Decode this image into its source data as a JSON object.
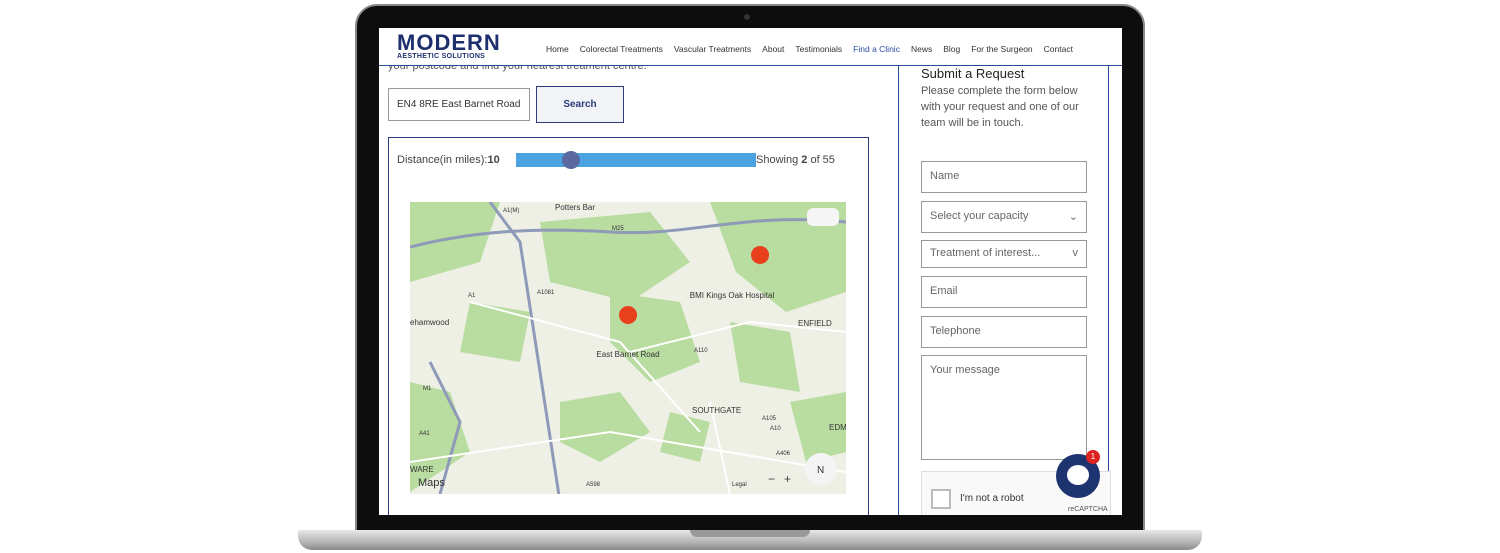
{
  "header": {
    "logo_main": "MODERN",
    "logo_sub": "AESTHETIC SOLUTIONS",
    "nav": [
      "Home",
      "Colorectal Treatments",
      "Vascular Treatments",
      "About",
      "Testimonials",
      "Find a Clinic",
      "News",
      "Blog",
      "For the Surgeon",
      "Contact"
    ],
    "active": "Find a Clinic"
  },
  "intro": "your postcode and find your nearest treament centre.",
  "search": {
    "value": "EN4 8RE East Barnet Road",
    "button": "Search"
  },
  "filter": {
    "label": "Distance(in miles):",
    "distance": "10",
    "slider_fraction": 0.2,
    "showing_prefix": "Showing ",
    "showing_count": "2",
    "showing_suffix": " of 55"
  },
  "map": {
    "labels": [
      "Potters Bar",
      "ehamwood",
      "ENFIELD",
      "SOUTHGATE",
      "EDMO",
      "WARE"
    ],
    "roads": [
      "A1(M)",
      "M25",
      "A1",
      "A1081",
      "A110",
      "A105",
      "A10",
      "A406",
      "A598",
      "M1",
      "A41"
    ],
    "pins": [
      "BMI Kings Oak Hospital",
      "East Barnet Road"
    ],
    "attribution": "Maps",
    "legal": "Legal",
    "compass": "N",
    "zoom_out": "−",
    "zoom_in": "+"
  },
  "form": {
    "title": "Submit a Request",
    "desc": "Please complete the form below with your request and one of our team will be in touch.",
    "name": "Name",
    "capacity": "Select your capacity",
    "treatment": "Treatment of interest...",
    "email": "Email",
    "telephone": "Telephone",
    "message": "Your message",
    "captcha": "I'm not a robot",
    "captcha_brand": "reCAPTCHA"
  },
  "chat": {
    "badge": "1"
  }
}
